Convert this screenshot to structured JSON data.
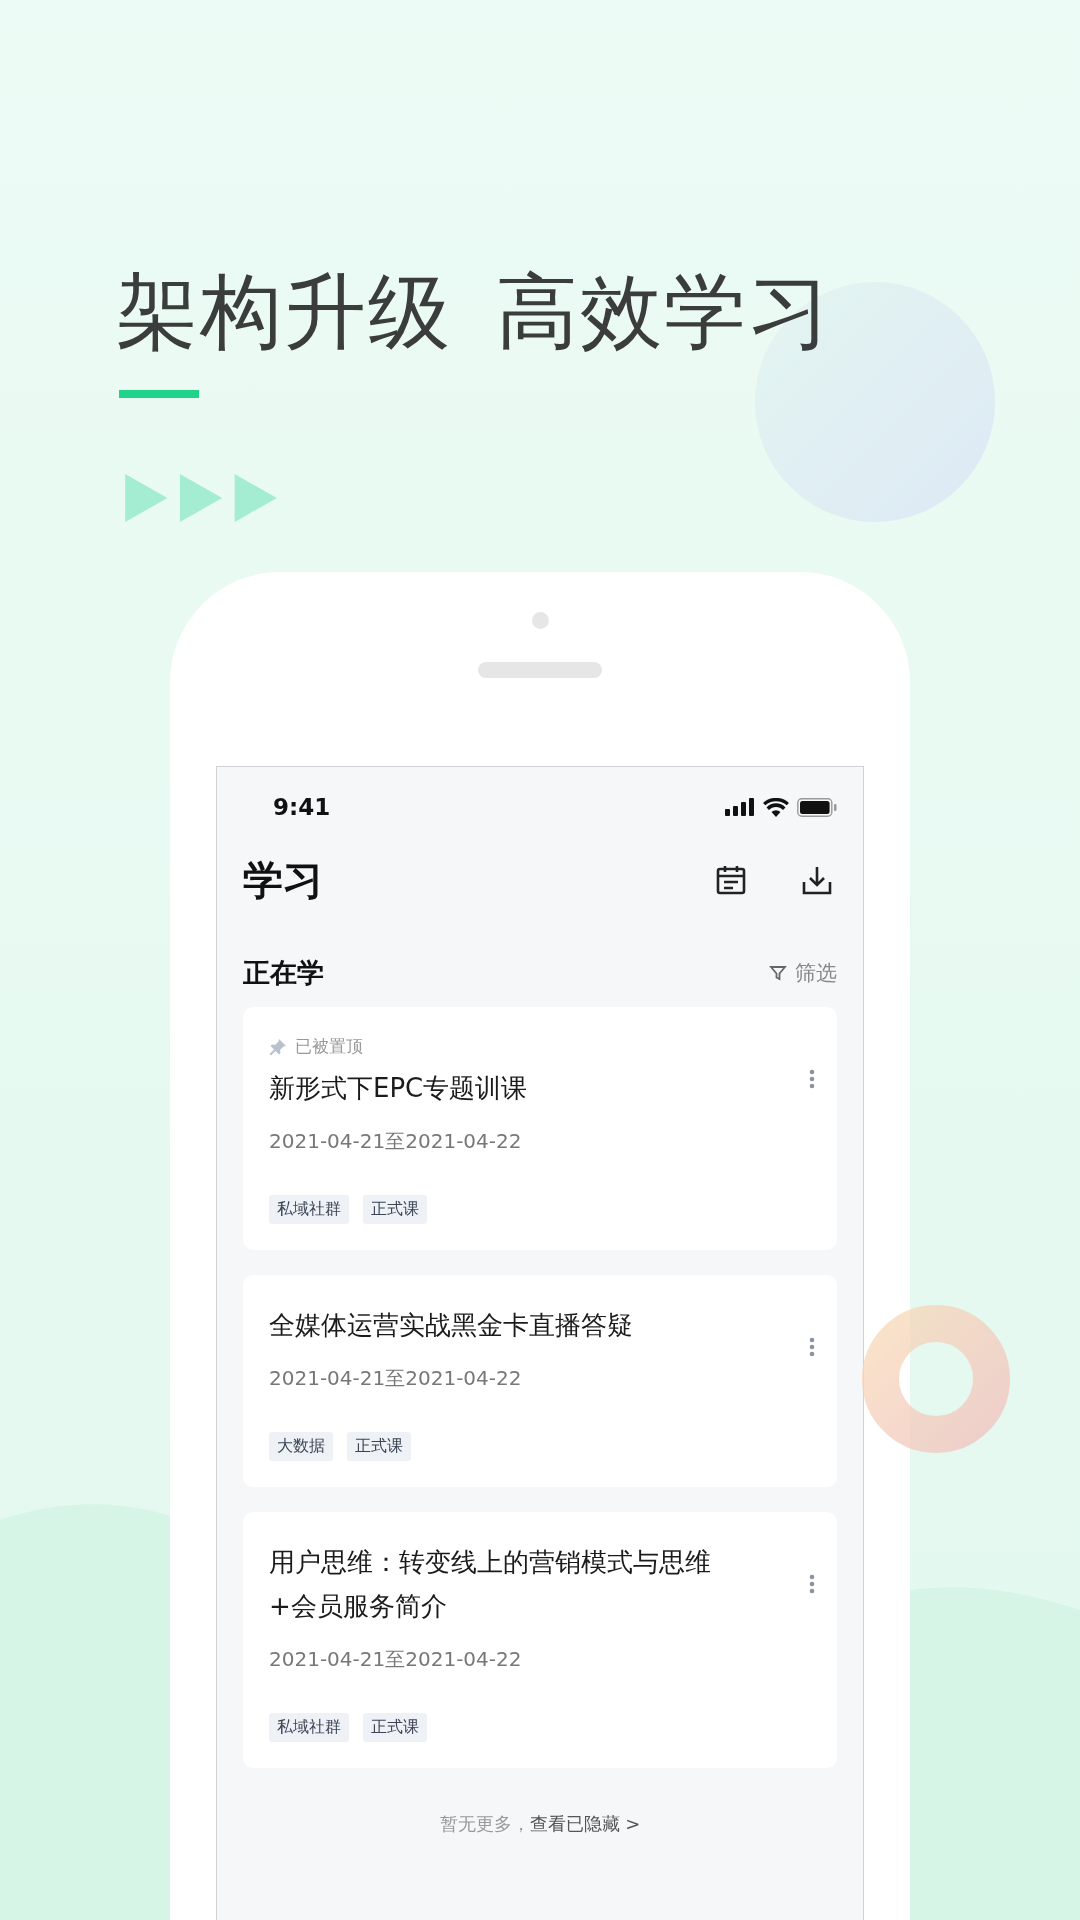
{
  "headline": [
    "架构升级",
    "高效学习"
  ],
  "screen": {
    "status_bar": {
      "time": "9:41"
    },
    "page_title": "学习",
    "section": {
      "title": "正在学",
      "filter": "筛选"
    },
    "courses": [
      {
        "pin_label": "已被置顶",
        "title": "新形式下EPC专题训课",
        "dates": "2021-04-21至2021-04-22",
        "tags": [
          "私域社群",
          "正式课"
        ]
      },
      {
        "title": "全媒体运营实战黑金卡直播答疑",
        "dates": "2021-04-21至2021-04-22",
        "tags": [
          "大数据",
          "正式课"
        ]
      },
      {
        "title": "用户思维：转变线上的营销模式与思维+会员服务简介",
        "dates": "2021-04-21至2021-04-22",
        "tags": [
          "私域社群",
          "正式课"
        ]
      }
    ],
    "footer": {
      "note": "暂无更多，",
      "link": "查看已隐藏 >"
    }
  }
}
